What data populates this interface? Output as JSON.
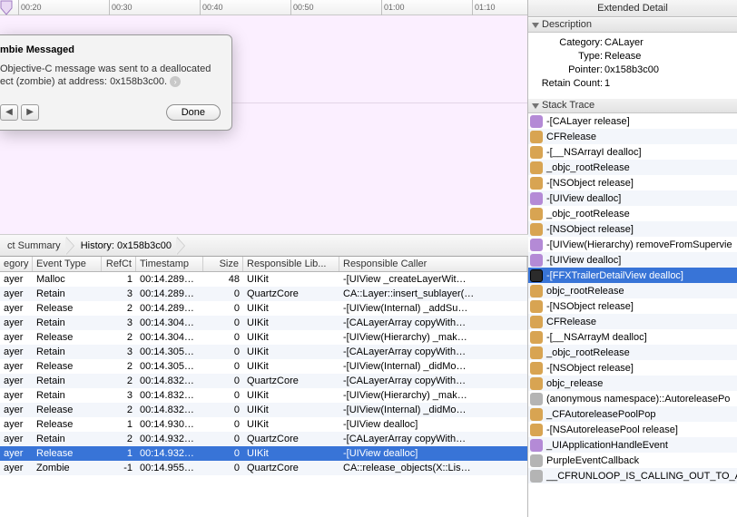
{
  "timeline": {
    "ticks": [
      "00:20",
      "00:30",
      "00:40",
      "00:50",
      "01:00",
      "01:10"
    ]
  },
  "popover": {
    "title": "mbie Messaged",
    "body_prefix": "Objective-C message was sent to a deallocated ect (zombie) at address: ",
    "address": "0x158b3c00",
    "done": "Done"
  },
  "pathbar": {
    "crumbs": [
      "ct Summary",
      "History: 0x158b3c00"
    ]
  },
  "table": {
    "headers": {
      "category": "egory",
      "event_type": "Event Type",
      "refct": "RefCt",
      "timestamp": "Timestamp",
      "size": "Size",
      "lib": "Responsible Lib...",
      "caller": "Responsible Caller"
    },
    "rows": [
      {
        "cat": "ayer",
        "et": "Malloc",
        "rc": "1",
        "ts": "00:14.289…",
        "sz": "48",
        "lib": "UIKit",
        "call": "-[UIView _createLayerWit…",
        "sel": false
      },
      {
        "cat": "ayer",
        "et": "Retain",
        "rc": "3",
        "ts": "00:14.289…",
        "sz": "0",
        "lib": "QuartzCore",
        "call": "CA::Layer::insert_sublayer(…",
        "sel": false
      },
      {
        "cat": "ayer",
        "et": "Release",
        "rc": "2",
        "ts": "00:14.289…",
        "sz": "0",
        "lib": "UIKit",
        "call": "-[UIView(Internal) _addSu…",
        "sel": false
      },
      {
        "cat": "ayer",
        "et": "Retain",
        "rc": "3",
        "ts": "00:14.304…",
        "sz": "0",
        "lib": "UIKit",
        "call": "-[CALayerArray copyWith…",
        "sel": false
      },
      {
        "cat": "ayer",
        "et": "Release",
        "rc": "2",
        "ts": "00:14.304…",
        "sz": "0",
        "lib": "UIKit",
        "call": "-[UIView(Hierarchy) _mak…",
        "sel": false
      },
      {
        "cat": "ayer",
        "et": "Retain",
        "rc": "3",
        "ts": "00:14.305…",
        "sz": "0",
        "lib": "UIKit",
        "call": "-[CALayerArray copyWith…",
        "sel": false
      },
      {
        "cat": "ayer",
        "et": "Release",
        "rc": "2",
        "ts": "00:14.305…",
        "sz": "0",
        "lib": "UIKit",
        "call": "-[UIView(Internal) _didMo…",
        "sel": false
      },
      {
        "cat": "ayer",
        "et": "Retain",
        "rc": "2",
        "ts": "00:14.832…",
        "sz": "0",
        "lib": "QuartzCore",
        "call": "-[CALayerArray copyWith…",
        "sel": false
      },
      {
        "cat": "ayer",
        "et": "Retain",
        "rc": "3",
        "ts": "00:14.832…",
        "sz": "0",
        "lib": "UIKit",
        "call": "-[UIView(Hierarchy) _mak…",
        "sel": false
      },
      {
        "cat": "ayer",
        "et": "Release",
        "rc": "2",
        "ts": "00:14.832…",
        "sz": "0",
        "lib": "UIKit",
        "call": "-[UIView(Internal) _didMo…",
        "sel": false
      },
      {
        "cat": "ayer",
        "et": "Release",
        "rc": "1",
        "ts": "00:14.930…",
        "sz": "0",
        "lib": "UIKit",
        "call": "-[UIView dealloc]",
        "sel": false
      },
      {
        "cat": "ayer",
        "et": "Retain",
        "rc": "2",
        "ts": "00:14.932…",
        "sz": "0",
        "lib": "QuartzCore",
        "call": "-[CALayerArray copyWith…",
        "sel": false
      },
      {
        "cat": "ayer",
        "et": "Release",
        "rc": "1",
        "ts": "00:14.932…",
        "sz": "0",
        "lib": "UIKit",
        "call": "-[UIView dealloc]",
        "sel": true
      },
      {
        "cat": "ayer",
        "et": "Zombie",
        "rc": "-1",
        "ts": "00:14.955…",
        "sz": "0",
        "lib": "QuartzCore",
        "call": "CA::release_objects(X::Lis…",
        "sel": false
      }
    ]
  },
  "right": {
    "title": "Extended Detail",
    "desc_header": "Description",
    "stack_header": "Stack Trace",
    "desc": {
      "Category": "CALayer",
      "Type": "Release",
      "Pointer": "0x158b3c00",
      "Retain Count": "1"
    },
    "stack": [
      {
        "c": "purple",
        "t": "-[CALayer release]",
        "sel": false
      },
      {
        "c": "orange",
        "t": "CFRelease",
        "sel": false
      },
      {
        "c": "orange",
        "t": "-[__NSArrayI dealloc]",
        "sel": false
      },
      {
        "c": "orange",
        "t": "_objc_rootRelease",
        "sel": false
      },
      {
        "c": "orange",
        "t": "-[NSObject release]",
        "sel": false
      },
      {
        "c": "purple",
        "t": "-[UIView dealloc]",
        "sel": false
      },
      {
        "c": "orange",
        "t": "_objc_rootRelease",
        "sel": false
      },
      {
        "c": "orange",
        "t": "-[NSObject release]",
        "sel": false
      },
      {
        "c": "purple",
        "t": "-[UIView(Hierarchy) removeFromSupervie",
        "sel": false
      },
      {
        "c": "purple",
        "t": "-[UIView dealloc]",
        "sel": false
      },
      {
        "c": "black",
        "t": "-[FFXTrailerDetailView dealloc]",
        "sel": true
      },
      {
        "c": "orange",
        "t": "objc_rootRelease",
        "sel": false
      },
      {
        "c": "orange",
        "t": "-[NSObject release]",
        "sel": false
      },
      {
        "c": "orange",
        "t": "CFRelease",
        "sel": false
      },
      {
        "c": "orange",
        "t": "-[__NSArrayM dealloc]",
        "sel": false
      },
      {
        "c": "orange",
        "t": "_objc_rootRelease",
        "sel": false
      },
      {
        "c": "orange",
        "t": "-[NSObject release]",
        "sel": false
      },
      {
        "c": "orange",
        "t": "objc_release",
        "sel": false
      },
      {
        "c": "gray",
        "t": "(anonymous namespace)::AutoreleasePo",
        "sel": false
      },
      {
        "c": "orange",
        "t": "_CFAutoreleasePoolPop",
        "sel": false
      },
      {
        "c": "orange",
        "t": "-[NSAutoreleasePool release]",
        "sel": false
      },
      {
        "c": "purple",
        "t": "_UIApplicationHandleEvent",
        "sel": false
      },
      {
        "c": "gray",
        "t": "PurpleEventCallback",
        "sel": false
      },
      {
        "c": "gray",
        "t": "__CFRUNLOOP_IS_CALLING_OUT_TO_A_S",
        "sel": false
      }
    ]
  }
}
